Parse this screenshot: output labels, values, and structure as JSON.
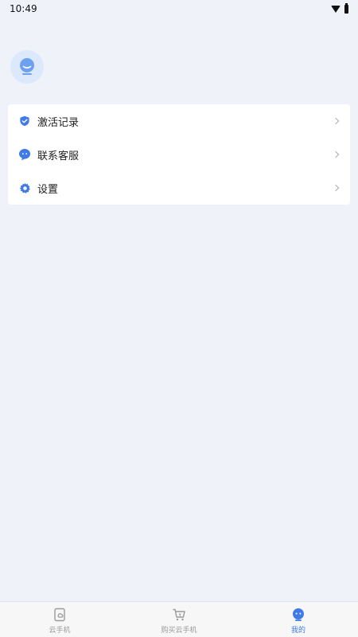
{
  "status_bar": {
    "time": "10:49",
    "icons": [
      "wifi-icon",
      "battery-icon"
    ]
  },
  "profile": {
    "avatar_icon": "user-avatar-icon"
  },
  "menu": {
    "items": [
      {
        "label": "激活记录",
        "icon": "activation-record-icon"
      },
      {
        "label": "联系客服",
        "icon": "customer-service-icon"
      },
      {
        "label": "设置",
        "icon": "settings-gear-icon"
      }
    ]
  },
  "tabbar": {
    "active_index": 2,
    "items": [
      {
        "label": "云手机",
        "icon": "cloud-phone-icon"
      },
      {
        "label": "购买云手机",
        "icon": "cart-icon"
      },
      {
        "label": "我的",
        "icon": "mine-icon"
      }
    ]
  },
  "colors": {
    "background": "#eff3f9",
    "accent": "#3f7ae6",
    "card": "#ffffff",
    "tab_inactive": "#9a9a9a"
  }
}
